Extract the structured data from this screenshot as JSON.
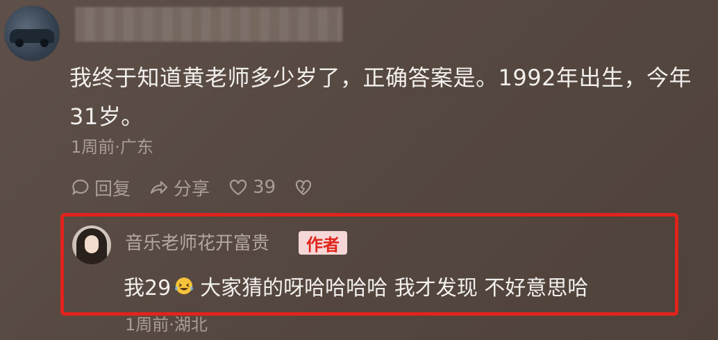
{
  "comment": {
    "text": "我终于知道黄老师多少岁了，正确答案是。1992年出生，今年31岁。",
    "meta": "1周前·广东",
    "actions": {
      "reply_label": "回复",
      "share_label": "分享",
      "like_count": "39"
    }
  },
  "reply": {
    "author_name": "音乐老师花开富贵",
    "author_badge": "作者",
    "text_part1": "我29",
    "emoji_icon": "laughing-tears-emoji",
    "text_part2": "大家猜的呀哈哈哈哈 我才发现 不好意思哈",
    "meta": "1周前·湖北"
  },
  "colors": {
    "highlight_border": "#e0241c",
    "badge_bg": "#f4d7d6",
    "badge_text": "#e0241c"
  }
}
